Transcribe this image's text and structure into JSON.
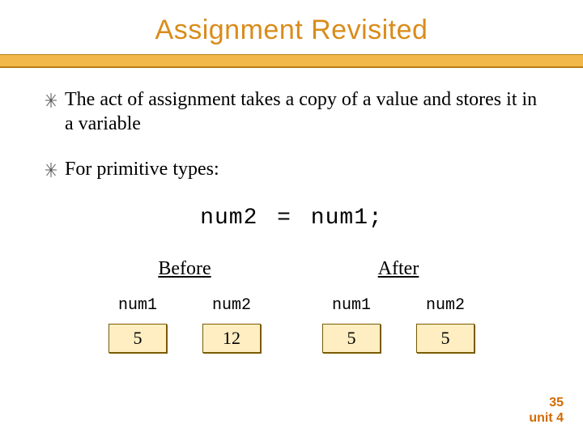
{
  "title": "Assignment Revisited",
  "bullets": [
    "The act of assignment takes a copy of a value and stores it in a variable",
    "For primitive types:"
  ],
  "code": "num2 = num1;",
  "diagram": {
    "before": {
      "heading": "Before",
      "vars": [
        {
          "label": "num1",
          "value": "5"
        },
        {
          "label": "num2",
          "value": "12"
        }
      ]
    },
    "after": {
      "heading": "After",
      "vars": [
        {
          "label": "num1",
          "value": "5"
        },
        {
          "label": "num2",
          "value": "5"
        }
      ]
    }
  },
  "footer": {
    "page": "35",
    "unit": "unit 4"
  },
  "colors": {
    "title": "#d98c1a",
    "band": "#f2b94a",
    "box_fill": "#ffeec2",
    "box_border": "#7a5a00",
    "footer": "#d26a00"
  }
}
